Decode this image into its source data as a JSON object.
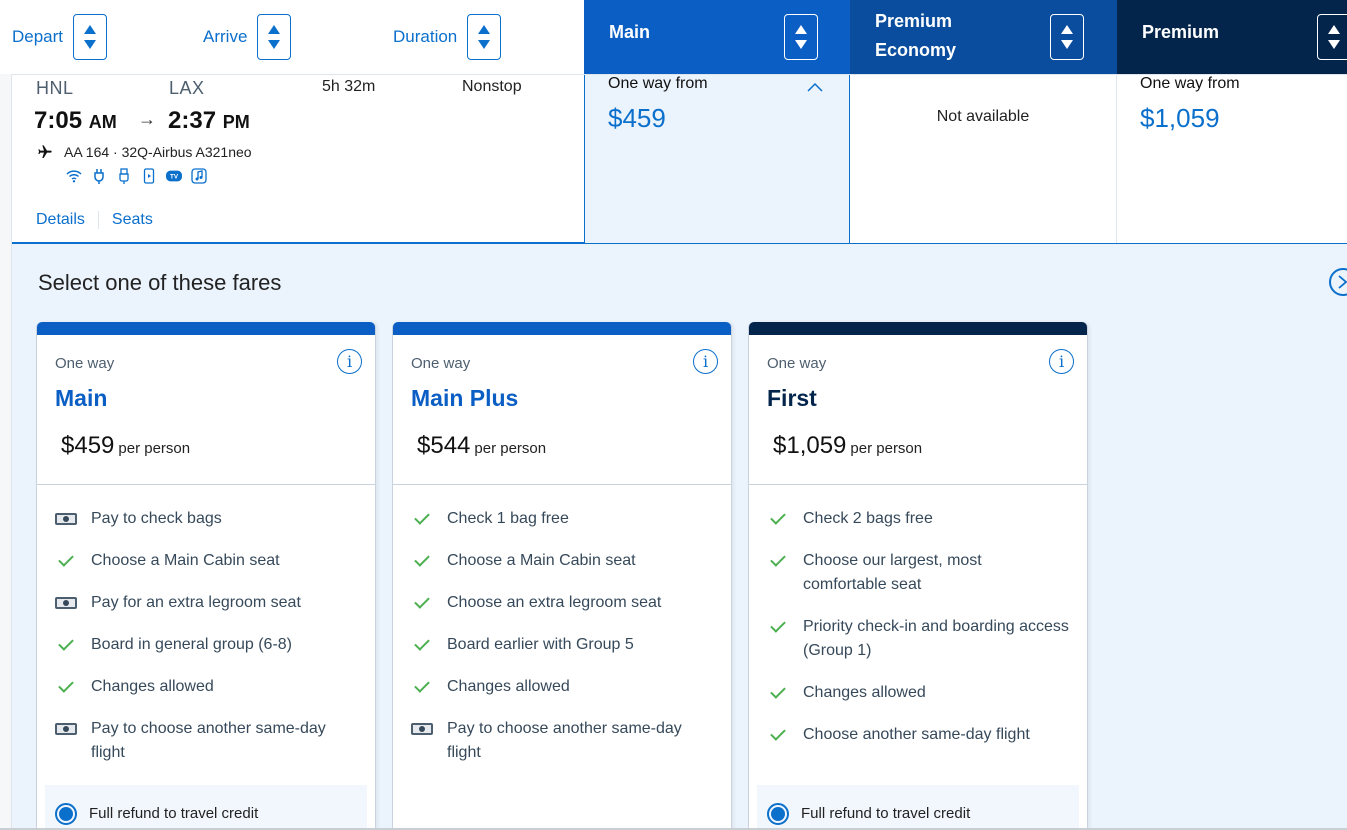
{
  "sort_bar": {
    "depart_label": "Depart",
    "arrive_label": "Arrive",
    "duration_label": "Duration"
  },
  "cabins": [
    {
      "label": "Main",
      "color": "#0b5fc4"
    },
    {
      "label": "Premium Economy",
      "label_line1": "Premium",
      "label_line2": "Economy",
      "color": "#0a4d9e"
    },
    {
      "label": "Premium",
      "color": "#03254c"
    }
  ],
  "flight": {
    "origin": "HNL",
    "destination": "LAX",
    "depart_time": "7:05",
    "depart_ampm": "AM",
    "arrive_time": "2:37",
    "arrive_ampm": "PM",
    "arrow": "→",
    "duration": "5h 32m",
    "stops": "Nonstop",
    "flight_number": "AA 164 · 32Q-Airbus A321neo",
    "amenities": [
      "wifi-icon",
      "power-outlet-icon",
      "usb-icon",
      "streaming-device-icon",
      "tv-icon",
      "music-icon"
    ],
    "details_link": "Details",
    "seats_link": "Seats"
  },
  "prices": {
    "main": {
      "label": "One way from",
      "price": "$459"
    },
    "premium_economy": {
      "label": "Not available"
    },
    "premium": {
      "label": "One way from",
      "price": "$1,059"
    }
  },
  "fares_panel": {
    "title": "Select one of these fares",
    "cards": [
      {
        "one_way": "One way",
        "name": "Main",
        "price": "$459",
        "per": "per person",
        "bar_color": "#0b5fc4",
        "features": [
          {
            "icon": "cash",
            "text": "Pay to check bags"
          },
          {
            "icon": "check",
            "text": "Choose a Main Cabin seat"
          },
          {
            "icon": "cash",
            "text": "Pay for an extra legroom seat"
          },
          {
            "icon": "check",
            "text": "Board in general group (6-8)"
          },
          {
            "icon": "check",
            "text": "Changes allowed"
          },
          {
            "icon": "cash",
            "text": "Pay to choose another same-day flight"
          }
        ],
        "refund": "Full refund to travel credit"
      },
      {
        "one_way": "One way",
        "name": "Main Plus",
        "price": "$544",
        "per": "per person",
        "bar_color": "#0b5fc4",
        "features": [
          {
            "icon": "check",
            "text": "Check 1 bag free"
          },
          {
            "icon": "check",
            "text": "Choose a Main Cabin seat"
          },
          {
            "icon": "check",
            "text": "Choose an extra legroom seat"
          },
          {
            "icon": "check",
            "text": "Board earlier with Group 5"
          },
          {
            "icon": "check",
            "text": "Changes allowed"
          },
          {
            "icon": "cash",
            "text": "Pay to choose another same-day flight"
          }
        ]
      },
      {
        "one_way": "One way",
        "name": "First",
        "price": "$1,059",
        "per": "per person",
        "bar_color": "#03254c",
        "features": [
          {
            "icon": "check",
            "text": "Check 2 bags free"
          },
          {
            "icon": "check",
            "text": "Choose our largest, most comfortable seat"
          },
          {
            "icon": "check",
            "text": "Priority check-in and boarding access (Group 1)"
          },
          {
            "icon": "check",
            "text": "Changes allowed"
          },
          {
            "icon": "check",
            "text": "Choose another same-day flight"
          }
        ],
        "refund": "Full refund to travel credit"
      }
    ]
  }
}
